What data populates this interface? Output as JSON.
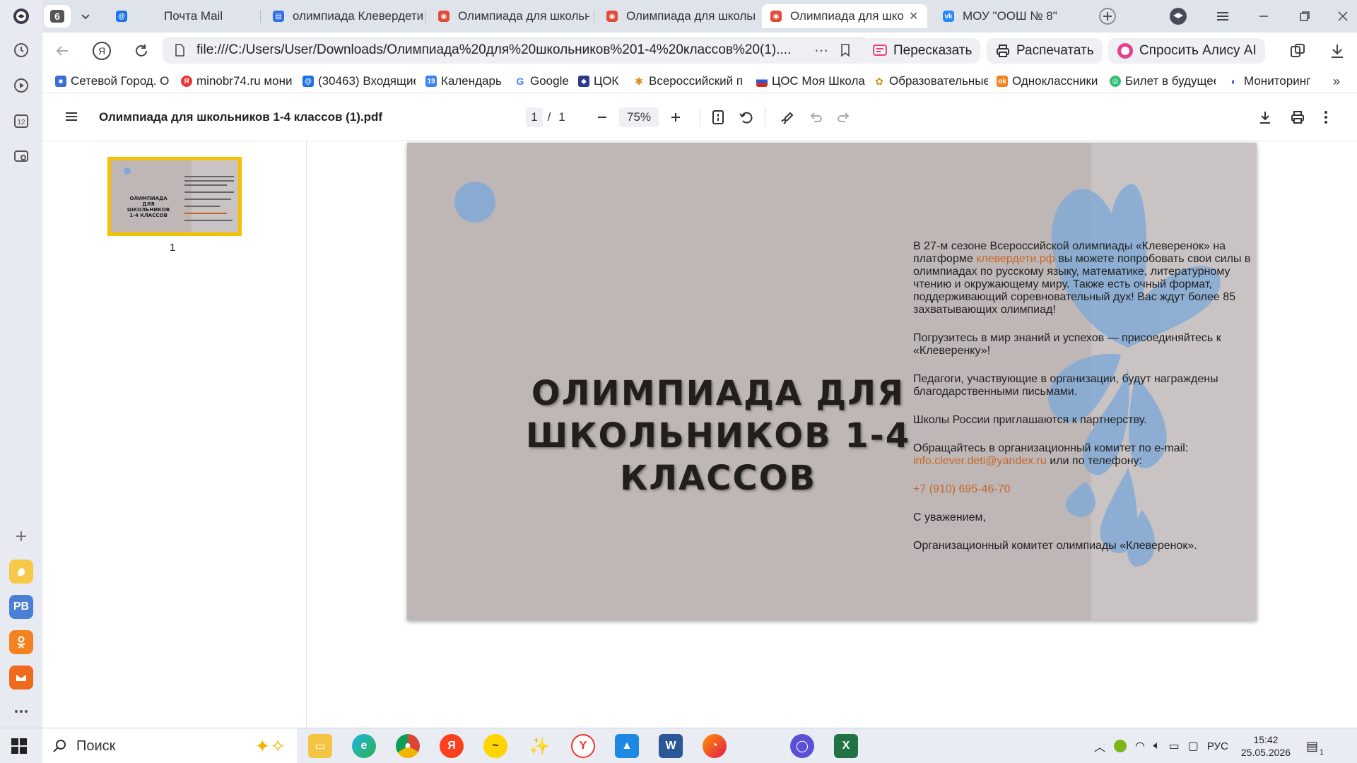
{
  "tabs": [
    {
      "label": "6",
      "kind": "counter"
    },
    {
      "label": "Почта Mail"
    },
    {
      "label": "олимпиада Клевердети"
    },
    {
      "label": "Олимпиада для школьн"
    },
    {
      "label": "Олимпиада для школьн"
    },
    {
      "label": "Олимпиада для шко",
      "active": true
    },
    {
      "label": "МОУ \"ООШ № 8\""
    }
  ],
  "address": {
    "url": "file:///C:/Users/User/Downloads/Олимпиада%20для%20школьников%201-4%20классов%20(1)...."
  },
  "toolbar_chips": {
    "retell": "Пересказать",
    "print": "Распечатать",
    "ask_alice": "Спросить Алису AI"
  },
  "bookmarks": [
    {
      "label": "Сетевой Город. О"
    },
    {
      "label": "minobr74.ru мони"
    },
    {
      "label": "(30463) Входящие"
    },
    {
      "label": "Календарь"
    },
    {
      "label": "Google"
    },
    {
      "label": "ЦОК"
    },
    {
      "label": "Всероссийский п"
    },
    {
      "label": "ЦОС Моя Школа"
    },
    {
      "label": "Образовательные"
    },
    {
      "label": "Одноклассники"
    },
    {
      "label": "Билет в будущее"
    },
    {
      "label": "Мониторинг"
    }
  ],
  "pdf": {
    "filename": "Олимпиада для школьников 1-4 классов (1).pdf",
    "page_current": "1",
    "page_sep": "/",
    "page_total": "1",
    "zoom": "75%",
    "thumb_number": "1",
    "thumb_title": "ОЛИМПИАДА ДЛЯ ШКОЛЬНИКОВ 1-4 КЛАССОВ"
  },
  "slide": {
    "title_line1": "ОЛИМПИАДА ДЛЯ",
    "title_line2": "ШКОЛЬНИКОВ 1-4",
    "title_line3": "КЛАССОВ",
    "p1_a": "В 27-м сезоне Всероссийской олимпиады «Клеверенок» на платформе ",
    "p1_link": "клевердети.рф",
    "p1_b": " вы можете попробовать свои силы в олимпиадах по русскому языку, математике, литературному чтению и окружающему миру. Также есть очный формат, поддерживающий соревновательный дух! Вас ждут более 85 захватывающих олимпиад!",
    "p2": "Погрузитесь в мир знаний и успехов — присоединяйтесь к «Клеверенку»!",
    "p3": "Педагоги, участвующие в организации, будут награждены благодарственными письмами.",
    "p4": "Школы России приглашаются к партнерству.",
    "p5_a": "Обращайтесь в организационный комитет по e-mail: ",
    "p5_email": "info.clever.deti@yandex.ru",
    "p5_b": " или по телефону:",
    "phone": "+7 (910) 695-46-70",
    "regards": "С уважением,",
    "signature": "Организационный комитет олимпиады «Клеверенок»."
  },
  "taskbar": {
    "search_label": "Поиск",
    "lang": "РУС",
    "time": "15:42",
    "date": "25.05.2026",
    "notif_count": "1"
  },
  "sidepanel": {
    "calendar_day": "12",
    "pb_label": "PB"
  },
  "colors": {
    "accent_orange": "#c5672a",
    "thumb_border": "#f2c200",
    "slide_bg": "#bfb7b6",
    "flower_blue": "#7fa9d6"
  }
}
